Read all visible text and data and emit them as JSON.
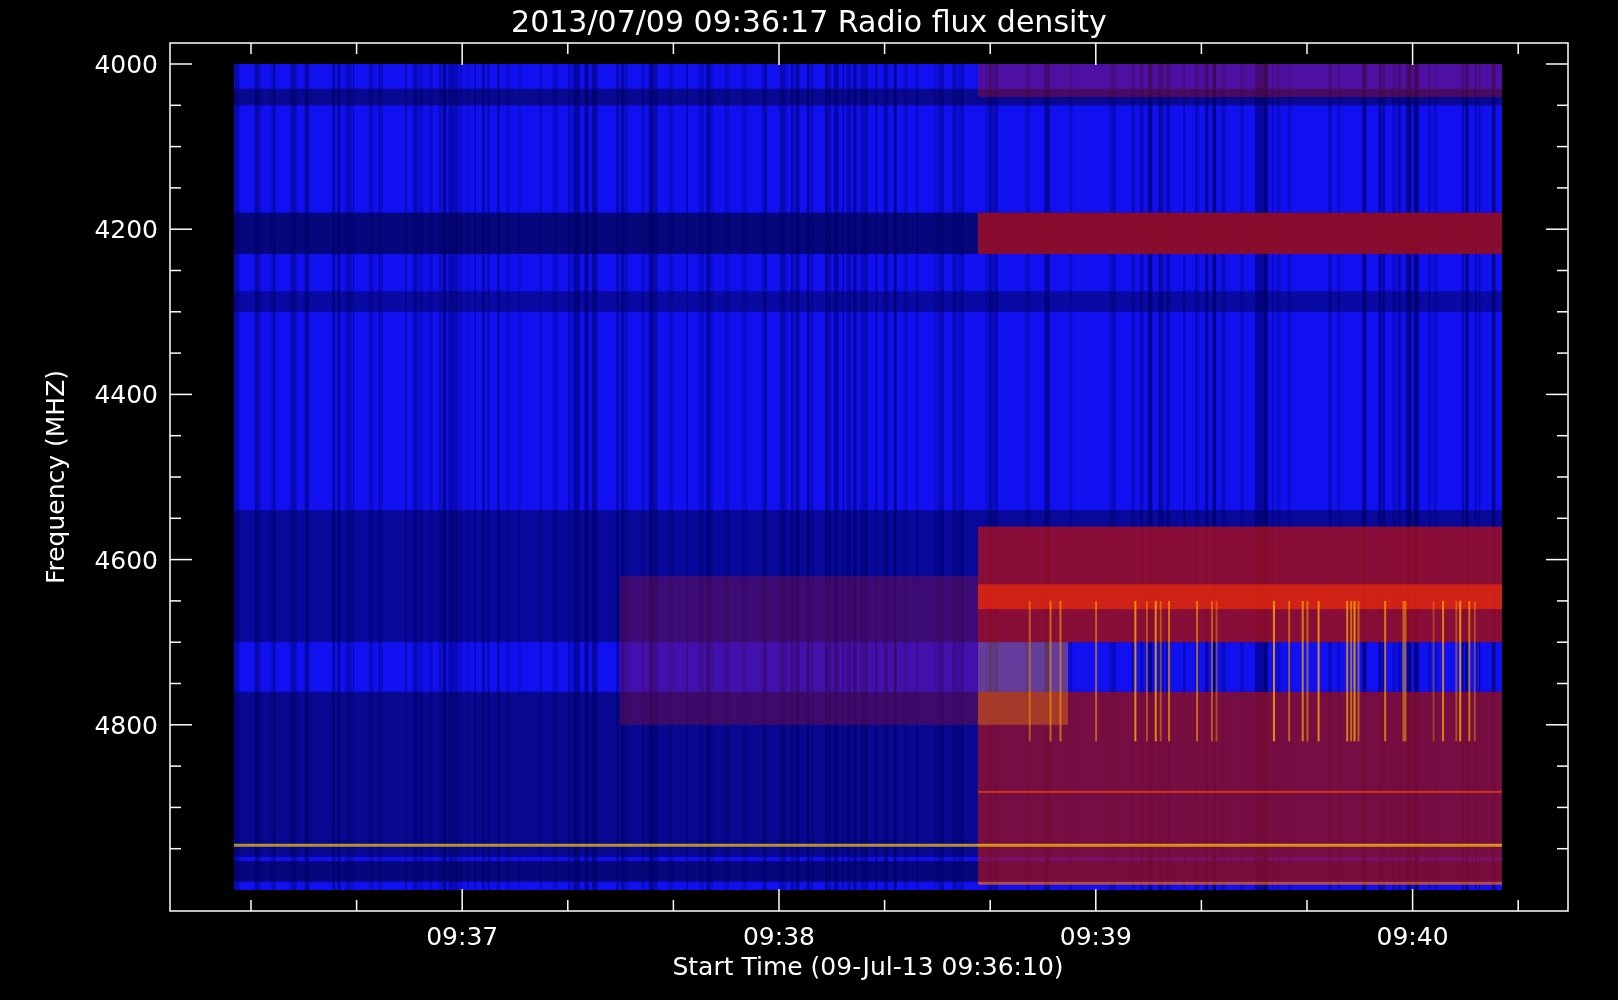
{
  "title": "2013/07/09 09:36:17 Radio flux density",
  "y_axis": {
    "label": "Frequency (MHZ)",
    "ticks": [
      "4000",
      "4200",
      "4400",
      "4600",
      "4800"
    ]
  },
  "x_axis": {
    "label": "Start Time (09-Jul-13 09:36:10)",
    "ticks": [
      "09:37",
      "09:38",
      "09:39",
      "09:40"
    ]
  }
}
